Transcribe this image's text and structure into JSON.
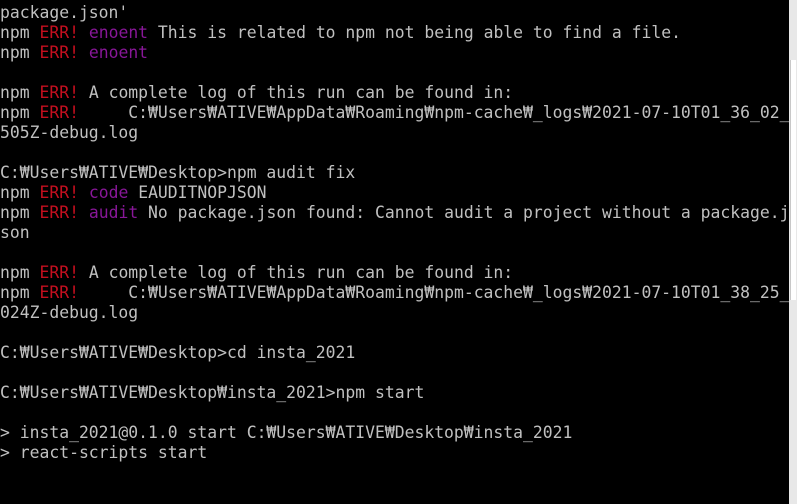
{
  "colors": {
    "background": "#000000",
    "text": "#c0c0c0",
    "err": "#c50f1f",
    "keyword": "#881798"
  },
  "terminal": {
    "lines": [
      [
        {
          "t": "package.json'"
        }
      ],
      [
        {
          "t": "npm "
        },
        {
          "t": "ERR!",
          "c": "err"
        },
        {
          "t": " "
        },
        {
          "t": "enoent",
          "c": "key"
        },
        {
          "t": " This is related to npm not being able to find a file."
        }
      ],
      [
        {
          "t": "npm "
        },
        {
          "t": "ERR!",
          "c": "err"
        },
        {
          "t": " "
        },
        {
          "t": "enoent",
          "c": "key"
        }
      ],
      [],
      [
        {
          "t": "npm "
        },
        {
          "t": "ERR!",
          "c": "err"
        },
        {
          "t": " A complete log of this run can be found in:"
        }
      ],
      [
        {
          "t": "npm "
        },
        {
          "t": "ERR!",
          "c": "err"
        },
        {
          "t": "     C:₩Users₩ATIVE₩AppData₩Roaming₩npm-cache₩_logs₩2021-07-10T01_36_02_"
        }
      ],
      [
        {
          "t": "505Z-debug.log"
        }
      ],
      [],
      [
        {
          "t": "C:₩Users₩ATIVE₩Desktop>npm audit fix"
        }
      ],
      [
        {
          "t": "npm "
        },
        {
          "t": "ERR!",
          "c": "err"
        },
        {
          "t": " "
        },
        {
          "t": "code",
          "c": "key"
        },
        {
          "t": " EAUDITNOPJSON"
        }
      ],
      [
        {
          "t": "npm "
        },
        {
          "t": "ERR!",
          "c": "err"
        },
        {
          "t": " "
        },
        {
          "t": "audit",
          "c": "key"
        },
        {
          "t": " No package.json found: Cannot audit a project without a package.j"
        }
      ],
      [
        {
          "t": "son"
        }
      ],
      [],
      [
        {
          "t": "npm "
        },
        {
          "t": "ERR!",
          "c": "err"
        },
        {
          "t": " A complete log of this run can be found in:"
        }
      ],
      [
        {
          "t": "npm "
        },
        {
          "t": "ERR!",
          "c": "err"
        },
        {
          "t": "     C:₩Users₩ATIVE₩AppData₩Roaming₩npm-cache₩_logs₩2021-07-10T01_38_25_"
        }
      ],
      [
        {
          "t": "024Z-debug.log"
        }
      ],
      [],
      [
        {
          "t": "C:₩Users₩ATIVE₩Desktop>cd insta_2021"
        }
      ],
      [],
      [
        {
          "t": "C:₩Users₩ATIVE₩Desktop₩insta_2021>npm start"
        }
      ],
      [],
      [
        {
          "t": "> insta_2021@0.1.0 start C:₩Users₩ATIVE₩Desktop₩insta_2021"
        }
      ],
      [
        {
          "t": "> react-scripts start"
        }
      ]
    ]
  }
}
